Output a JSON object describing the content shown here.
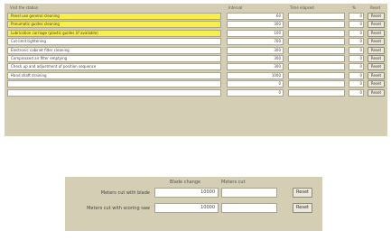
{
  "table": {
    "headers": {
      "task": "Visit the station",
      "interval": "Interval",
      "time_elapsed": "Time elapsed",
      "percent": "%",
      "reset": "Reset"
    },
    "rows": [
      {
        "task": "Panel use general cleaning",
        "interval": "60",
        "percent": "0",
        "reset": "Reset",
        "highlight": true
      },
      {
        "task": "Pneumatic guides cleaning",
        "interval": "300",
        "percent": "0",
        "reset": "Reset",
        "highlight": true
      },
      {
        "task": "Lubrication carriage (plastic guides (if available)",
        "interval": "100",
        "percent": "0",
        "reset": "Reset",
        "highlight": true
      },
      {
        "task": "Cut-limit tightening",
        "interval": "700",
        "percent": "0",
        "reset": "Reset",
        "highlight": false
      },
      {
        "task": "Electronic cabinet filter cleaning",
        "interval": "300",
        "percent": "0",
        "reset": "Reset",
        "highlight": false
      },
      {
        "task": "Compressed air filter emptying",
        "interval": "300",
        "percent": "0",
        "reset": "Reset",
        "highlight": false
      },
      {
        "task": "Check up and adjustment of position sequence",
        "interval": "300",
        "percent": "0",
        "reset": "Reset",
        "highlight": false
      },
      {
        "task": "Hand shaft draining",
        "interval": "1000",
        "percent": "0",
        "reset": "Reset",
        "highlight": false
      },
      {
        "task": "",
        "interval": "0",
        "percent": "0",
        "reset": "Reset",
        "highlight": false
      },
      {
        "task": "",
        "interval": "0",
        "percent": "0",
        "reset": "Reset",
        "highlight": false
      }
    ]
  },
  "blade_panel": {
    "header_blade_change": "Blade change",
    "header_meters_cut": "Meters cut",
    "rows": [
      {
        "label": "Meters cut with blade",
        "value": "10000",
        "reset": "Reset"
      },
      {
        "label": "Meters cut with scoring saw",
        "value": "10000",
        "reset": "Reset"
      }
    ]
  }
}
